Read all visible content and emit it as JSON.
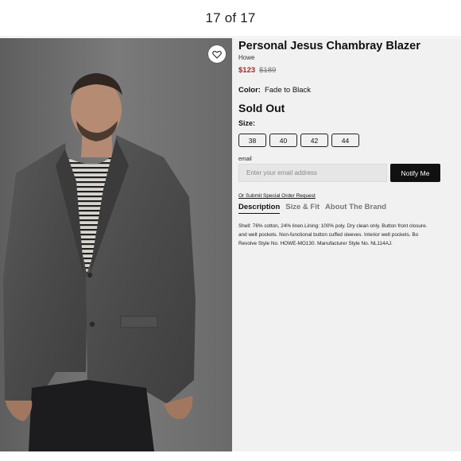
{
  "gallery": {
    "counter": "17 of 17"
  },
  "product": {
    "title": "Personal Jesus Chambray Blazer",
    "brand": "Howe",
    "price": {
      "sale": "$123",
      "original": "$189",
      "sale_color": "#a4282b"
    },
    "color": {
      "label": "Color:",
      "value": "Fade to Black"
    },
    "status": "Sold Out",
    "size_label": "Size:",
    "sizes": [
      "38",
      "40",
      "42",
      "44"
    ]
  },
  "notify": {
    "email_label": "email",
    "email_placeholder": "Enter your email address",
    "button_label": "Notify Me"
  },
  "special_order_link": "Or Submit Special Order Request",
  "tabs": [
    "Description",
    "Size & Fit",
    "About The Brand"
  ],
  "description": {
    "lines": [
      "Shell: 76% cotton, 24% linen.Lining: 100% poly. Dry clean only. Button front closure.",
      "and welt pockets. Non-functional button cuffed sleeves. Interior welt pockets. Bo",
      "Revolve Style No. HOWE-MO130. Manufacturer Style No. NL114AJ."
    ]
  },
  "icons": {
    "favorite": "heart-icon"
  },
  "colors": {
    "background": "#f1f1f1",
    "button_dark": "#111111"
  }
}
